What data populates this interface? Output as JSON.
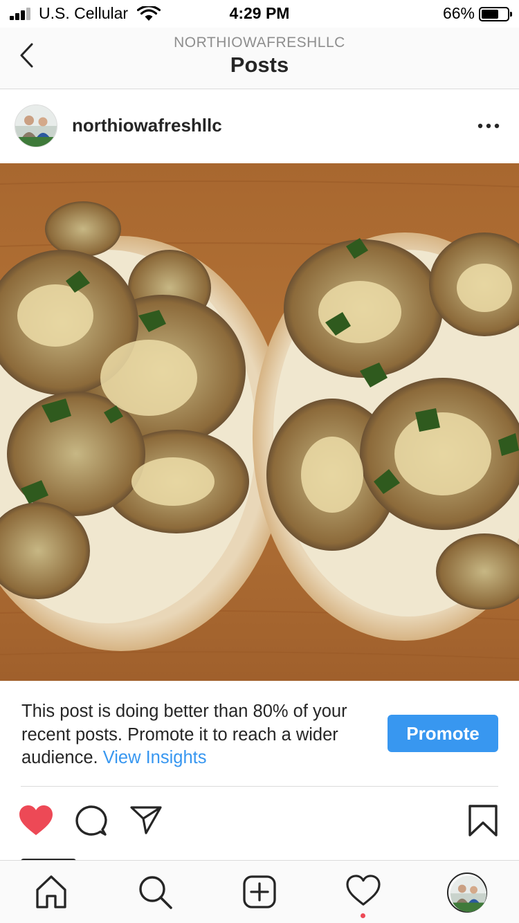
{
  "status_bar": {
    "carrier": "U.S. Cellular",
    "time": "4:29 PM",
    "battery_percent": "66%",
    "battery_level": 0.66,
    "signal_bars": 3
  },
  "header": {
    "account": "NORTHIOWAFRESHLLC",
    "title": "Posts"
  },
  "post": {
    "username": "northiowafreshllc",
    "image_icon": "photo-of-two-eggplant-flatbread-pizzas"
  },
  "promo": {
    "message": "This post is doing better than 80% of your recent posts. Promote it to reach a wider audience.",
    "insights_link": "View Insights",
    "button_label": "Promote"
  },
  "actions": {
    "liked": true,
    "like_color": "#ed4956"
  },
  "tabs": [
    {
      "name": "home"
    },
    {
      "name": "search"
    },
    {
      "name": "new-post"
    },
    {
      "name": "activity",
      "has_notification": true
    },
    {
      "name": "profile"
    }
  ],
  "colors": {
    "accent": "#3897f0",
    "like": "#ed4956",
    "text": "#262626",
    "muted": "#8e8e8e"
  }
}
